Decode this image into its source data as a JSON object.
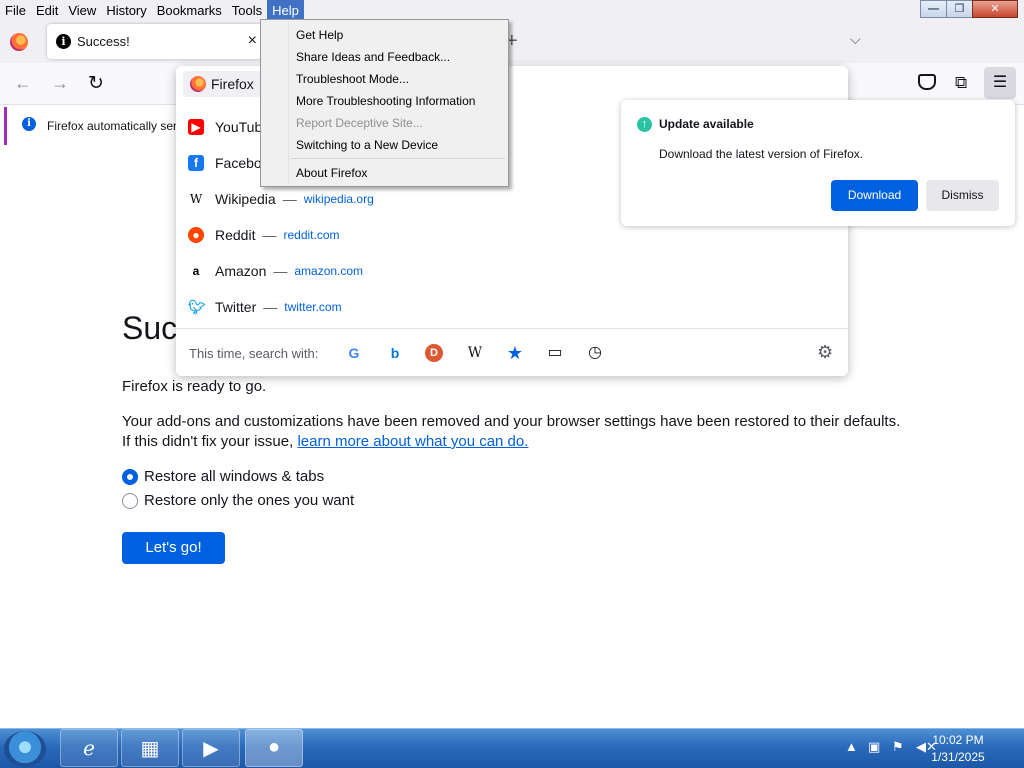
{
  "menubar": [
    "File",
    "Edit",
    "View",
    "History",
    "Bookmarks",
    "Tools",
    "Help"
  ],
  "window": {
    "minimize": "—",
    "maximize": "❐",
    "close": "✕"
  },
  "tab": {
    "title": "Success!",
    "close": "×"
  },
  "urlbar": {
    "chip": "Firefox"
  },
  "suggestions": [
    {
      "name": "YouTub",
      "url": ""
    },
    {
      "name": "Faceboo",
      "url": ""
    },
    {
      "name": "Wikipedia",
      "url": "wikipedia.org"
    },
    {
      "name": "Reddit",
      "url": "reddit.com"
    },
    {
      "name": "Amazon",
      "url": "amazon.com"
    },
    {
      "name": "Twitter",
      "url": "twitter.com"
    }
  ],
  "search_with": "This time, search with:",
  "notification": "Firefox automatically sen",
  "help_menu": [
    "Get Help",
    "Share Ideas and Feedback...",
    "Troubleshoot Mode...",
    "More Troubleshooting Information",
    "Report Deceptive Site...",
    "Switching to a New Device",
    "About Firefox"
  ],
  "update": {
    "title": "Update available",
    "desc": "Download the latest version of Firefox.",
    "download": "Download",
    "dismiss": "Dismiss"
  },
  "page": {
    "heading": "Succ",
    "ready": "Firefox is ready to go.",
    "p1": "Your add-ons and customizations have been removed and your browser settings have been restored to their defaults.",
    "p2_prefix": "If this didn't fix your issue, ",
    "p2_link": "learn more about what you can do.",
    "radio1": "Restore all windows & tabs",
    "radio2": "Restore only the ones you want",
    "button": "Let's go!"
  },
  "taskbar": {
    "time": "10:02 PM",
    "date": "1/31/2025"
  }
}
